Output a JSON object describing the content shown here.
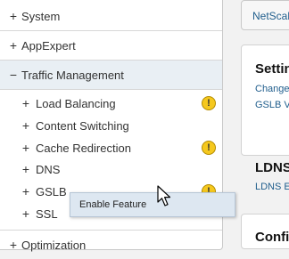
{
  "nav": {
    "top_items": [
      {
        "label": "System",
        "sign": "+"
      },
      {
        "label": "AppExpert",
        "sign": "+"
      },
      {
        "label": "Traffic Management",
        "sign": "−"
      }
    ],
    "sub_items": [
      {
        "label": "Load Balancing",
        "sign": "+",
        "warning": true
      },
      {
        "label": "Content Switching",
        "sign": "+",
        "warning": false
      },
      {
        "label": "Cache Redirection",
        "sign": "+",
        "warning": true
      },
      {
        "label": "DNS",
        "sign": "+",
        "warning": false
      },
      {
        "label": "GSLB",
        "sign": "+",
        "warning": true
      },
      {
        "label": "SSL",
        "sign": "+",
        "warning": false
      }
    ],
    "bottom_item": {
      "label": "Optimization",
      "sign": "+"
    },
    "warning_glyph": "!"
  },
  "context_menu": {
    "items": [
      "Enable Feature"
    ]
  },
  "right": {
    "tab_label": "NetScal",
    "settings_card": {
      "title": "Settin",
      "links": [
        "Change",
        "GSLB V"
      ]
    },
    "ldns_card": {
      "title": "LDNS",
      "link": "LDNS E"
    },
    "config_card": {
      "title": "Confi"
    }
  },
  "colors": {
    "warning": "#f5c81e",
    "link": "#1f5d8c",
    "menu_bg": "#dde7f1",
    "selected_row": "#e9eff4"
  }
}
